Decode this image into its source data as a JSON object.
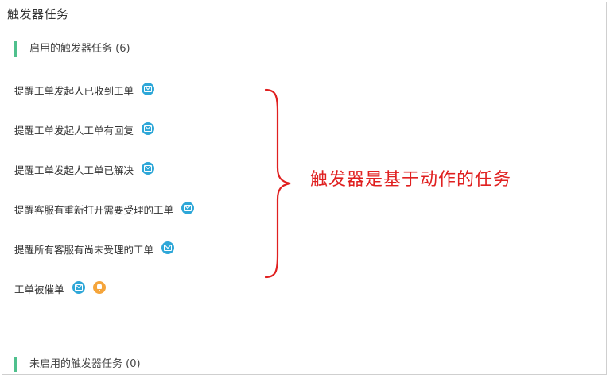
{
  "panel": {
    "title": "触发器任务"
  },
  "enabled_section": {
    "label": "启用的触发器任务 (6)"
  },
  "disabled_section": {
    "label": "未启用的触发器任务 (0)"
  },
  "tasks": [
    {
      "label": "提醒工单发起人已收到工单",
      "icons": [
        "mail-icon"
      ]
    },
    {
      "label": "提醒工单发起人工单有回复",
      "icons": [
        "mail-icon"
      ]
    },
    {
      "label": "提醒工单发起人工单已解决",
      "icons": [
        "mail-icon"
      ]
    },
    {
      "label": "提醒客服有重新打开需要受理的工单",
      "icons": [
        "mail-icon"
      ]
    },
    {
      "label": "提醒所有客服有尚未受理的工单",
      "icons": [
        "mail-icon"
      ]
    },
    {
      "label": "工单被催单",
      "icons": [
        "mail-icon",
        "bell-icon"
      ]
    }
  ],
  "annotation": {
    "text": "触发器是基于动作的任务",
    "color": "#e02020"
  },
  "colors": {
    "accent": "#4fc08d",
    "mail": "#2ea7d8",
    "bell": "#f5a53b"
  }
}
